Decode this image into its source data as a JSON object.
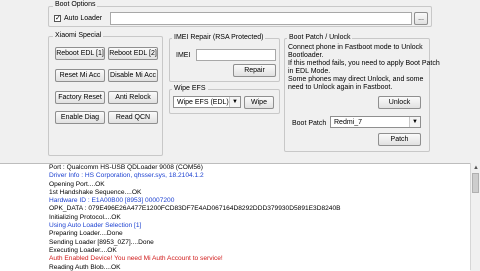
{
  "boot_options": {
    "title": "Boot Options",
    "auto_loader_label": "Auto Loader",
    "auto_loader_checked": true,
    "loader_path": "",
    "browse_label": "..."
  },
  "xiaomi": {
    "title": "Xiaomi Special",
    "buttons": [
      "Reboot EDL [1]",
      "Reboot EDL [2]",
      "Reset Mi Acc",
      "Disable Mi Acc",
      "Factory Reset",
      "Anti Relock",
      "Enable Diag",
      "Read QCN"
    ]
  },
  "imei": {
    "title": "IMEI Repair (RSA Protected)",
    "label": "IMEI",
    "value": "",
    "repair_label": "Repair"
  },
  "wipe_efs": {
    "title": "Wipe EFS",
    "selected": "Wipe EFS (EDL)",
    "wipe_label": "Wipe"
  },
  "boot_patch": {
    "title": "Boot Patch / Unlock",
    "info_lines": [
      "Connect phone in Fastboot mode to Unlock",
      "Bootloader.",
      "If this method fails, you need to apply Boot Patch",
      "in EDL Mode.",
      "Some phones may direct Unlock, and some",
      "need to Unlock again in Fastboot."
    ],
    "unlock_label": "Unlock",
    "boot_patch_label": "Boot Patch",
    "model_selected": "Redmi_7",
    "patch_label": "Patch"
  },
  "log": {
    "lines": [
      {
        "text": "Port          : Qualcomm HS-USB QDLoader 9008 (COM56)",
        "color": "#000000"
      },
      {
        "text": "Driver Info   : HS Corporation, qhsser.sys, 18.2104.1.2",
        "color": "#1a3fd0"
      },
      {
        "text": "Opening Port....OK",
        "color": "#000000"
      },
      {
        "text": "1st Handshake Sequence....OK",
        "color": "#000000"
      },
      {
        "text": "Hardware ID   : E1A00B00 [8953] 00007200",
        "color": "#1a3fd0"
      },
      {
        "text": "OPK_DATA      : 079E496E26A477E1200FCD83DF7E4AD067164D8292DDD379930D5891E3D8240B",
        "color": "#000000"
      },
      {
        "text": "Initializing Protocol....OK",
        "color": "#000000"
      },
      {
        "text": "Using Auto Loader Selection [1]",
        "color": "#1a3fd0"
      },
      {
        "text": "Preparing Loader....Done",
        "color": "#000000"
      },
      {
        "text": "Sending Loader [8953_0Z7]....Done",
        "color": "#000000"
      },
      {
        "text": "Executing Loader....OK",
        "color": "#000000"
      },
      {
        "text": "Auth Enabled Device! You need Mi Auth Account to service!",
        "color": "#d01a1a"
      },
      {
        "text": "Reading Auth Blob....OK",
        "color": "#000000"
      }
    ]
  }
}
